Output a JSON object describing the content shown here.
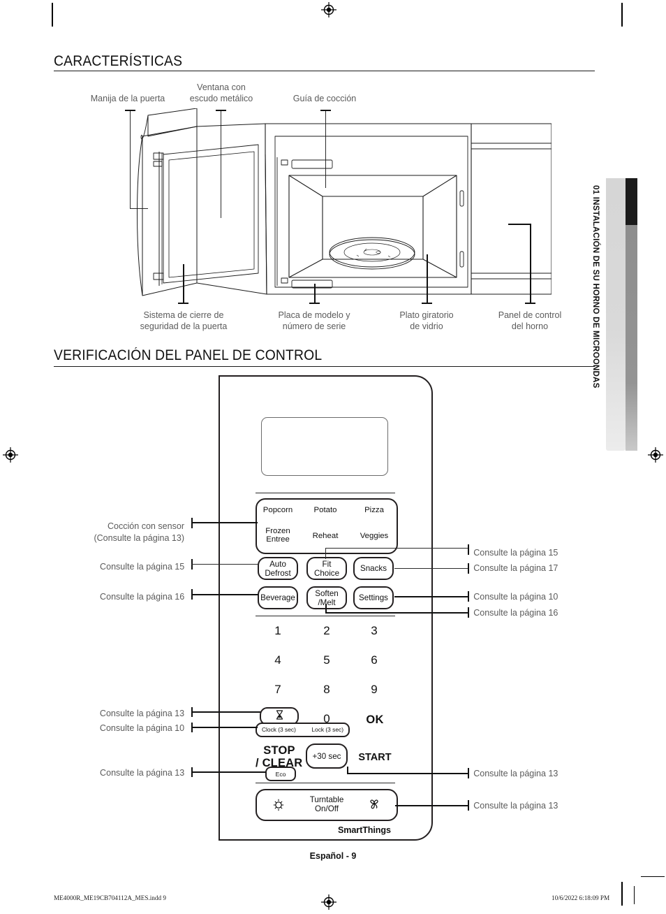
{
  "page": {
    "page_label": "Español - 9",
    "footer_file": "ME4000R_ME19CB704112A_MES.indd   9",
    "footer_timestamp": "10/6/2022   6:18:09 PM"
  },
  "side_tab": {
    "text": "01  INSTALACIÓN DE SU HORNO DE MICROONDAS"
  },
  "sections": [
    {
      "title": "CARACTERÍSTICAS"
    },
    {
      "title": "VERIFICACIÓN DEL PANEL DE CONTROL"
    }
  ],
  "features_diagram": {
    "top_labels": [
      {
        "id": "door-handle",
        "text": "Manija de la puerta"
      },
      {
        "id": "window",
        "line1": "Ventana con",
        "line2": "escudo metálico"
      },
      {
        "id": "cooking-guide",
        "text": "Guía de cocción"
      }
    ],
    "bottom_labels": [
      {
        "id": "door-safety-lock",
        "line1": "Sistema de cierre de",
        "line2": "seguridad de la puerta"
      },
      {
        "id": "model-plate",
        "line1": "Placa de modelo y",
        "line2": "número de serie"
      },
      {
        "id": "glass-turntable",
        "line1": "Plato giratorio",
        "line2": "de vidrio"
      },
      {
        "id": "control-panel",
        "line1": "Panel de control",
        "line2": "del horno"
      }
    ]
  },
  "control_panel": {
    "sensor_cook_label": {
      "line1": "Cocción con sensor",
      "line2": "(Consulte la página 13)"
    },
    "sensor_buttons": [
      {
        "id": "popcorn",
        "label": "Popcorn"
      },
      {
        "id": "potato",
        "label": "Potato"
      },
      {
        "id": "pizza",
        "label": "Pizza"
      },
      {
        "id": "frozen-entree",
        "line1": "Frozen",
        "line2": "Entree"
      },
      {
        "id": "reheat",
        "label": "Reheat"
      },
      {
        "id": "veggies",
        "label": "Veggies"
      }
    ],
    "buttons": [
      {
        "id": "auto-defrost",
        "line1": "Auto",
        "line2": "Defrost"
      },
      {
        "id": "fit-choice",
        "line1": "Fit",
        "line2": "Choice"
      },
      {
        "id": "snacks",
        "line1": "Snacks",
        "line2": ""
      },
      {
        "id": "beverage",
        "line1": "Beverage",
        "line2": ""
      },
      {
        "id": "soften-melt",
        "line1": "Soften",
        "line2": "/Melt"
      },
      {
        "id": "settings",
        "line1": "Settings",
        "line2": ""
      }
    ],
    "keypad": [
      "1",
      "2",
      "3",
      "4",
      "5",
      "6",
      "7",
      "8",
      "9"
    ],
    "zero": "0",
    "ok": "OK",
    "timer_icon": "hourglass-icon",
    "clock_label": "Clock (3 sec)",
    "lock_label": "Lock (3 sec)",
    "stop_line1": "STOP",
    "stop_line2": "/ CLEAR",
    "eco_label": "Eco",
    "add30_label": "+30 sec",
    "start_label": "START",
    "turntable_line1": "Turntable",
    "turntable_line2": "On/Off",
    "light_icon": "lamp-icon",
    "fan_icon": "fan-icon",
    "smartthings_label": "SmartThings",
    "left_callouts": [
      {
        "id": "auto-defrost-ref",
        "text": "Consulte la página 15"
      },
      {
        "id": "beverage-ref",
        "text": "Consulte la página 16"
      },
      {
        "id": "timer-ref",
        "text": "Consulte la página 13"
      },
      {
        "id": "clock-ref",
        "text": "Consulte la página 10"
      },
      {
        "id": "eco-ref",
        "text": "Consulte la página 13"
      }
    ],
    "right_callouts": [
      {
        "id": "fit-choice-ref",
        "text": "Consulte la página 15"
      },
      {
        "id": "snacks-ref",
        "text": "Consulte la página 17"
      },
      {
        "id": "soften-melt-ref",
        "text": "Consulte la página 10"
      },
      {
        "id": "settings-ref",
        "text": "Consulte la página 16"
      },
      {
        "id": "add30-ref",
        "text": "Consulte la página 13"
      },
      {
        "id": "turntable-ref",
        "text": "Consulte la página 13"
      }
    ]
  }
}
